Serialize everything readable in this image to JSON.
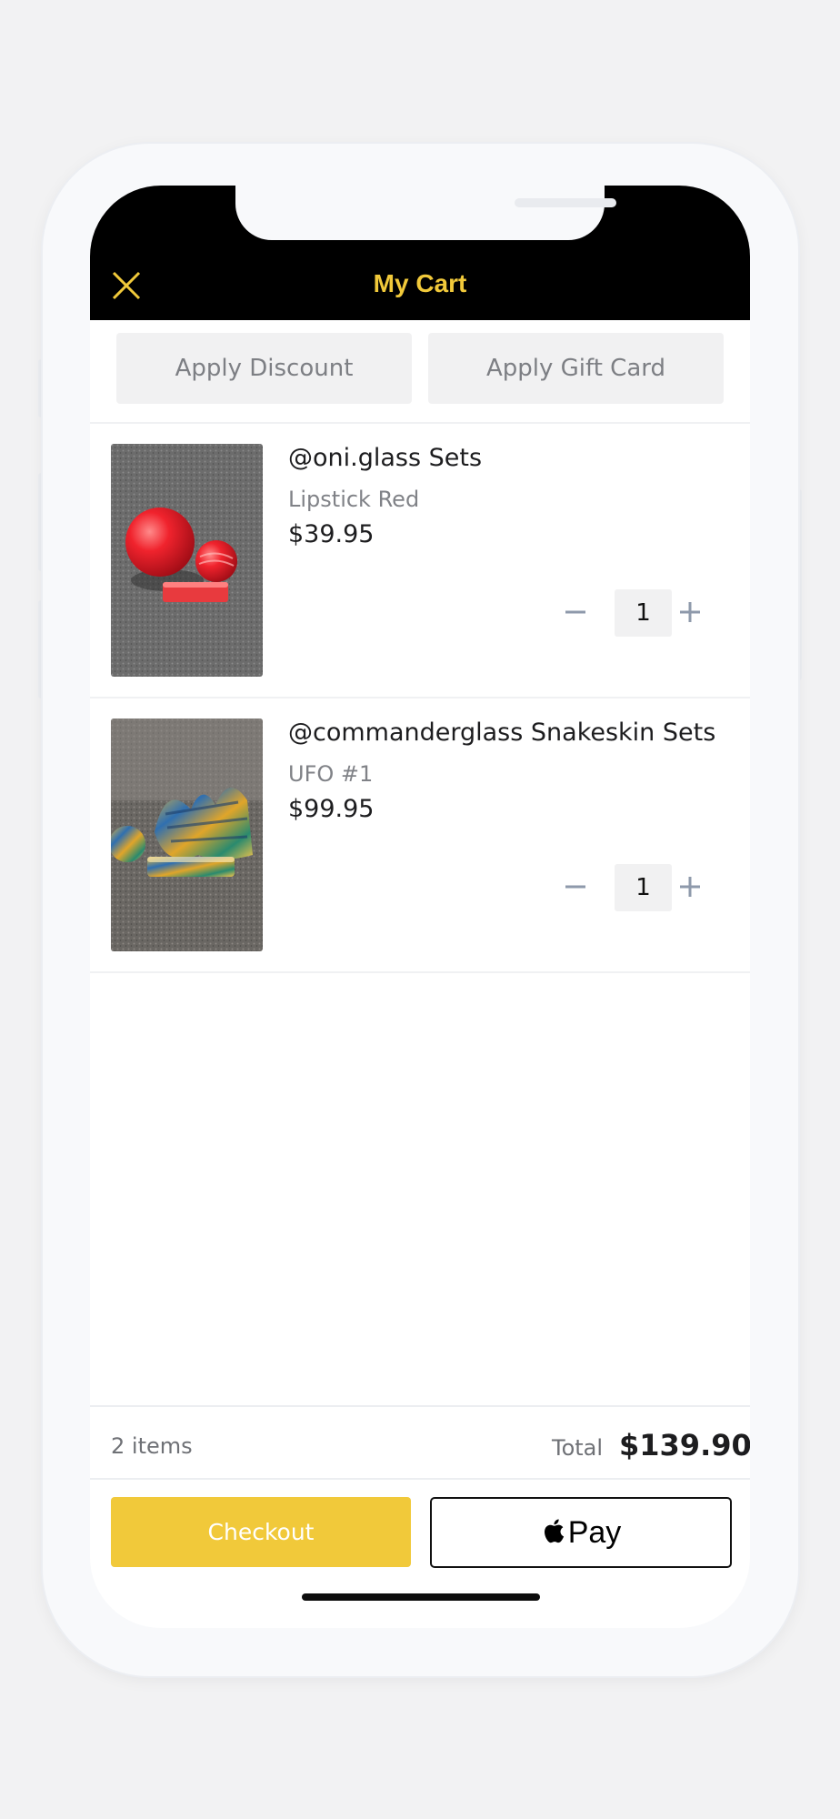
{
  "header": {
    "title": "My Cart",
    "close_icon": "close-icon"
  },
  "actions": {
    "discount_label": "Apply Discount",
    "gift_card_label": "Apply Gift Card"
  },
  "cart": {
    "items": [
      {
        "name": "@oni.glass Sets",
        "variant": "Lipstick Red",
        "price": "$39.95",
        "quantity": "1"
      },
      {
        "name": "@commanderglass Snakeskin Sets",
        "variant": "UFO #1",
        "price": "$99.95",
        "quantity": "1"
      }
    ]
  },
  "summary": {
    "items_count": "2 items",
    "total_label": "Total",
    "total_value": "$139.90"
  },
  "buttons": {
    "checkout_label": "Checkout",
    "apple_pay_label": "Pay",
    "apple_pay_icon": "apple-logo-icon"
  },
  "colors": {
    "accent": "#f1c93a",
    "header_bg": "#000000"
  }
}
